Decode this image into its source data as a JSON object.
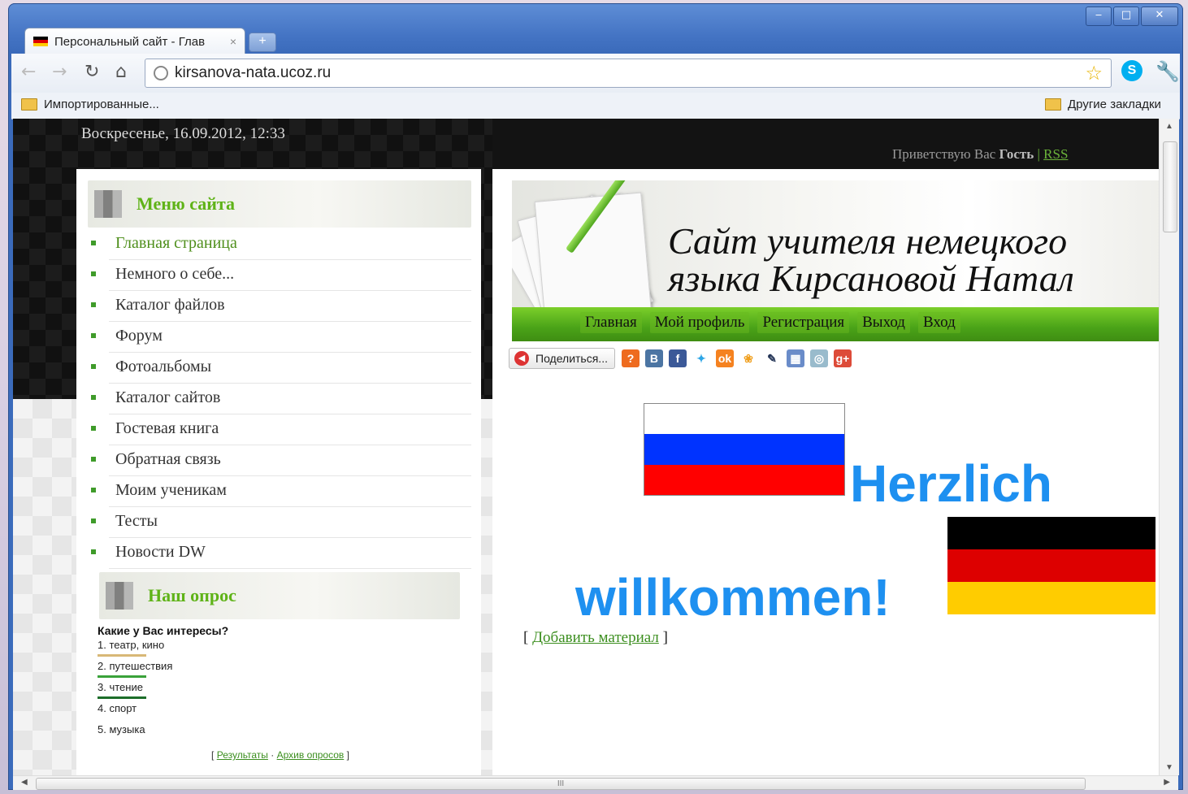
{
  "browser": {
    "tab_title": "Персональный сайт - Глав",
    "tab_close": "×",
    "new_tab": "+",
    "url": "kirsanova-nata.ucoz.ru",
    "window_controls": {
      "minimize": "‒",
      "maximize": "□",
      "close": "✕"
    },
    "bookmarks": {
      "left": "Импортированные...",
      "right": "Другие закладки"
    }
  },
  "page": {
    "datetime": "Воскресенье, 16.09.2012, 12:33",
    "greeting_prefix": "Приветствую Вас",
    "greeting_user": "Гость",
    "rss": "RSS",
    "site_title_line1": "Сайт учителя немецкого",
    "site_title_line2": "языка Кирсановой Натал",
    "nav": [
      "Главная",
      "Мой профиль",
      "Регистрация",
      "Выход",
      "Вход"
    ],
    "share_label": "Поделиться...",
    "welcome_word1": "Herzlich",
    "welcome_word2": "willkommen!",
    "add_material": "Добавить материал",
    "add_material_open": "[",
    "add_material_close": "]"
  },
  "sidebar": {
    "menu_title": "Меню сайта",
    "menu_items": [
      "Главная страница",
      "Немного о себе...",
      "Каталог файлов",
      "Форум",
      "Фотоальбомы",
      "Каталог сайтов",
      "Гостевая книга",
      "Обратная связь",
      "Моим ученикам",
      "Тесты",
      "Новости DW"
    ],
    "poll_title": "Наш опрос",
    "poll_question": "Какие у Вас интересы?",
    "poll_options": [
      {
        "label": "1. театр, кино",
        "share": 0.3,
        "color": "#d8b877"
      },
      {
        "label": "2. путешествия",
        "share": 0.3,
        "color": "#3aa23a"
      },
      {
        "label": "3. чтение",
        "share": 0.3,
        "color": "#1d6e2a"
      },
      {
        "label": "4. спорт",
        "share": 0,
        "color": "#3aa23a"
      },
      {
        "label": "5. музыка",
        "share": 0,
        "color": "#3aa23a"
      }
    ],
    "poll_links": {
      "results": "Результаты",
      "archive": "Архив опросов",
      "dot": "·",
      "open": "[",
      "close": "]"
    }
  },
  "colors": {
    "accent_green": "#5fb318",
    "welcome_blue": "#1e90f0",
    "flag_ru": [
      "#ffffff",
      "#0033ff",
      "#ff0000"
    ],
    "flag_de": [
      "#000000",
      "#dd0000",
      "#ffcc00"
    ]
  },
  "icons": {
    "share_services": [
      "ask-icon",
      "vk-icon",
      "facebook-icon",
      "twitter-icon",
      "odnoklassniki-icon",
      "moimir-icon",
      "livejournal-icon",
      "delicious-icon",
      "bobrdobr-icon",
      "google-plus-icon"
    ]
  }
}
